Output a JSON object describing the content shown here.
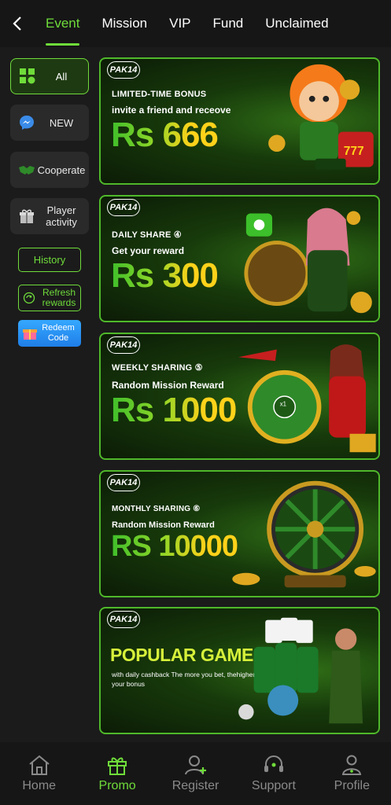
{
  "topbar": {
    "tabs": [
      {
        "label": "Event",
        "active": true
      },
      {
        "label": "Mission"
      },
      {
        "label": "VIP"
      },
      {
        "label": "Fund"
      },
      {
        "label": "Unclaimed"
      }
    ],
    "back_icon": "chevron-left-icon"
  },
  "sidebar": {
    "categories": [
      {
        "label": "All",
        "icon": "grid-icon",
        "active": true
      },
      {
        "label": "NEW",
        "icon": "messenger-icon"
      },
      {
        "label": "Cooperate",
        "icon": "handshake-icon"
      },
      {
        "label": "Player activity",
        "icon": "gift-icon"
      }
    ],
    "history": "History",
    "refresh": "Refresh rewards",
    "redeem": "Redeem Code"
  },
  "banners": [
    {
      "logo": "PAK14",
      "kicker": "LIMITED-TIME BONUS",
      "sub": "invite a friend and receove",
      "amount": "Rs 666"
    },
    {
      "logo": "PAK14",
      "kicker": "DAILY SHARE ④",
      "sub": "Get your reward",
      "amount": "Rs 300"
    },
    {
      "logo": "PAK14",
      "kicker": "WEEKLY SHARING ⑤",
      "sub": "Random Mission Reward",
      "amount": "Rs 1000"
    },
    {
      "logo": "PAK14",
      "kicker": "MONTHLY SHARING ⑥",
      "sub": "Random Mission Reward",
      "amount": "RS 10000"
    },
    {
      "logo": "PAK14",
      "title": "POPULAR GAMES",
      "desc": "with daily cashback The more you bet, thehigher your bonus"
    }
  ],
  "bottom_nav": [
    {
      "label": "Home",
      "icon": "home-icon"
    },
    {
      "label": "Promo",
      "icon": "gift-icon",
      "active": true
    },
    {
      "label": "Register",
      "icon": "user-add-icon"
    },
    {
      "label": "Support",
      "icon": "headset-icon"
    },
    {
      "label": "Profile",
      "icon": "profile-icon"
    }
  ],
  "colors": {
    "accent": "#6fdc3a",
    "background": "#1b1b1b",
    "gold": "#f2d21a"
  }
}
